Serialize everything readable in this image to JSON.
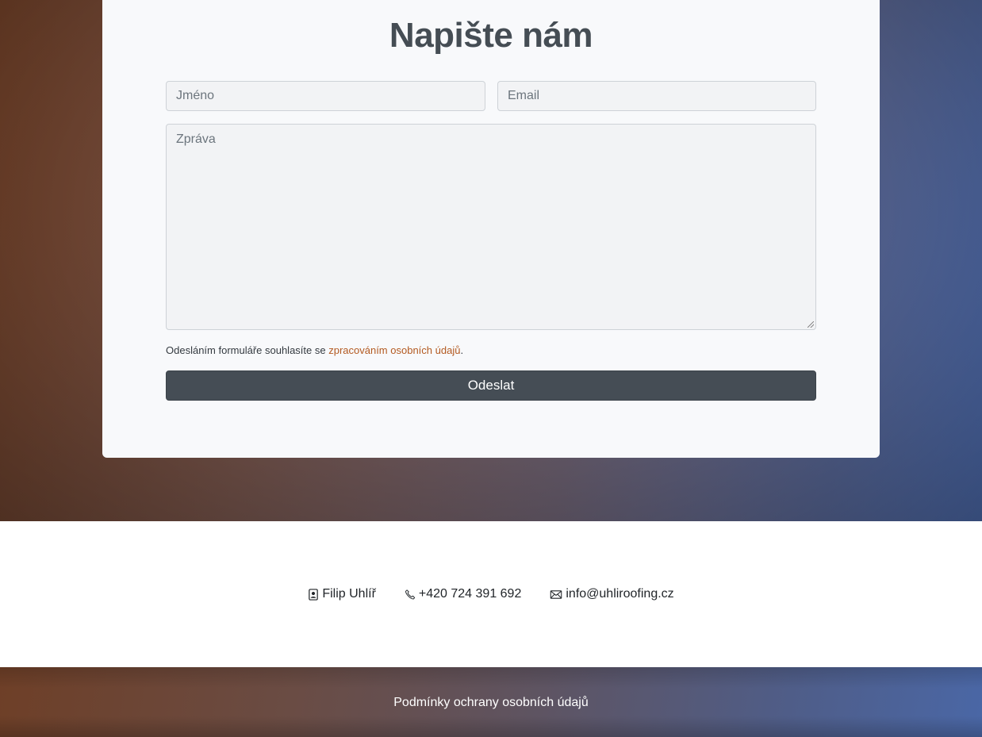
{
  "form": {
    "title": "Napište nám",
    "name_placeholder": "Jméno",
    "email_placeholder": "Email",
    "message_placeholder": "Zpráva",
    "consent_text": "Odesláním formuláře souhlasíte se ",
    "consent_link": "zpracováním osobních údajů",
    "consent_end": ".",
    "submit_label": "Odeslat"
  },
  "contact": {
    "person": "Filip Uhlíř",
    "phone": "+420 724 391 692",
    "email": "info@uhliroofing.cz"
  },
  "footer": {
    "privacy_link": "Podmínky ochrany osobních údajů"
  },
  "colors": {
    "link_accent": "#b35a21",
    "button_bg": "#454d55"
  }
}
